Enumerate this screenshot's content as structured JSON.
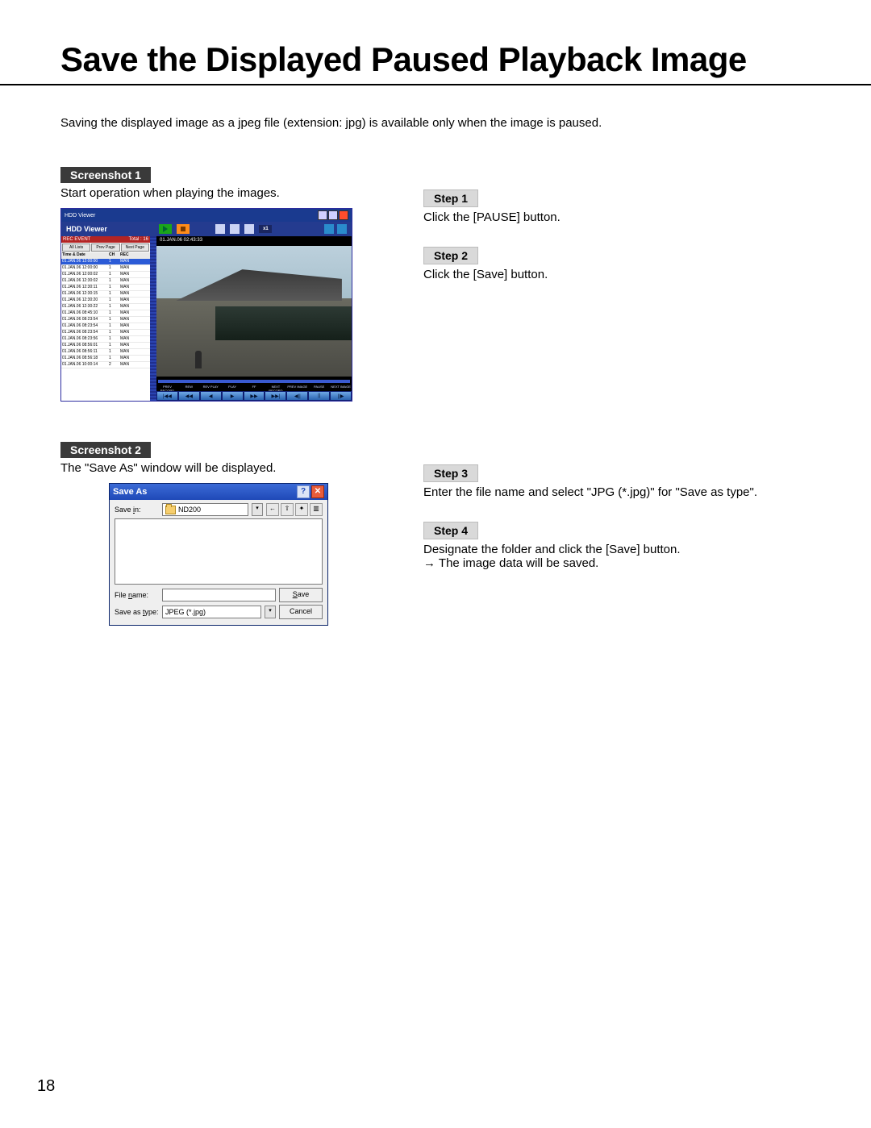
{
  "title": "Save the Displayed Paused Playback Image",
  "intro": "Saving the displayed image as a jpeg file (extension: jpg) is available only when the image is paused.",
  "page_number": "18",
  "section1": {
    "label": "Screenshot 1",
    "caption": "Start operation when playing the images."
  },
  "section2": {
    "label": "Screenshot 2",
    "caption": "The \"Save As\" window will be displayed."
  },
  "steps": {
    "s1": {
      "label": "Step 1",
      "text": "Click the [PAUSE] button."
    },
    "s2": {
      "label": "Step 2",
      "text": "Click the [Save] button."
    },
    "s3": {
      "label": "Step 3",
      "text": "Enter the file name and select \"JPG (*.jpg)\" for \"Save as type\"."
    },
    "s4": {
      "label": "Step 4",
      "text": "Designate the folder and click the [Save] button.",
      "result": "The image data will be saved."
    }
  },
  "hdd": {
    "window_title": "HDD Viewer",
    "subtitle": "HDD Viewer",
    "speed_badge": "x1",
    "rec_head_left": "REC EVENT",
    "rec_head_right": "Total : 16",
    "rec_buttons": [
      "All Lists",
      "Prev Page",
      "Next Page"
    ],
    "cols": [
      "Time & Date",
      "CH",
      "REC"
    ],
    "rows": [
      {
        "t": "01.JAN.06 12:00:00",
        "c": "1",
        "r": "MAN"
      },
      {
        "t": "01.JAN.06 12:00:00",
        "c": "1",
        "r": "MAN"
      },
      {
        "t": "01.JAN.06 12:00:02",
        "c": "1",
        "r": "MAN"
      },
      {
        "t": "01.JAN.06 12:30:02",
        "c": "1",
        "r": "MAN"
      },
      {
        "t": "01.JAN.06 12:30:11",
        "c": "1",
        "r": "MAN"
      },
      {
        "t": "01.JAN.06 12:30:15",
        "c": "1",
        "r": "MAN"
      },
      {
        "t": "01.JAN.06 12:30:20",
        "c": "1",
        "r": "MAN"
      },
      {
        "t": "01.JAN.06 12:30:22",
        "c": "1",
        "r": "MAN"
      },
      {
        "t": "01.JAN.06 08:45:10",
        "c": "1",
        "r": "MAN"
      },
      {
        "t": "01.JAN.06 08:23:54",
        "c": "1",
        "r": "MAN"
      },
      {
        "t": "01.JAN.06 08:23:54",
        "c": "1",
        "r": "MAN"
      },
      {
        "t": "01.JAN.06 08:23:54",
        "c": "1",
        "r": "MAN"
      },
      {
        "t": "01.JAN.06 08:23:56",
        "c": "1",
        "r": "MAN"
      },
      {
        "t": "01.JAN.06 08:56:01",
        "c": "1",
        "r": "MAN"
      },
      {
        "t": "01.JAN.06 08:56:11",
        "c": "1",
        "r": "MAN"
      },
      {
        "t": "01.JAN.06 08:56:18",
        "c": "1",
        "r": "MAN"
      },
      {
        "t": "01.JAN.06 10:00:14",
        "c": "2",
        "r": "MAN"
      }
    ],
    "video_stamp": "01.JAN.06  02:43:33",
    "ctrl_labels": [
      "PREV RECORD",
      "REW",
      "REV PLAY",
      "PLAY",
      "FF",
      "NEXT RECORD",
      "PREV IMAGE",
      "PAUSE",
      "NEXT IMAGE"
    ],
    "ctrl_glyphs": [
      "|◀◀",
      "◀◀",
      "◀",
      "▶",
      "▶▶",
      "▶▶|",
      "◀||",
      "||",
      "||▶"
    ]
  },
  "saveas": {
    "title": "Save As",
    "savein_label_pre": "Save ",
    "savein_label_u": "i",
    "savein_label_post": "n:",
    "savein_value": "ND200",
    "filename_label_pre": "File ",
    "filename_label_u": "n",
    "filename_label_post": "ame:",
    "type_label_pre": "Save as ",
    "type_label_u": "t",
    "type_label_post": "ype:",
    "type_value": "JPEG (*.jpg)",
    "save_u": "S",
    "save_rest": "ave",
    "cancel": "Cancel"
  }
}
